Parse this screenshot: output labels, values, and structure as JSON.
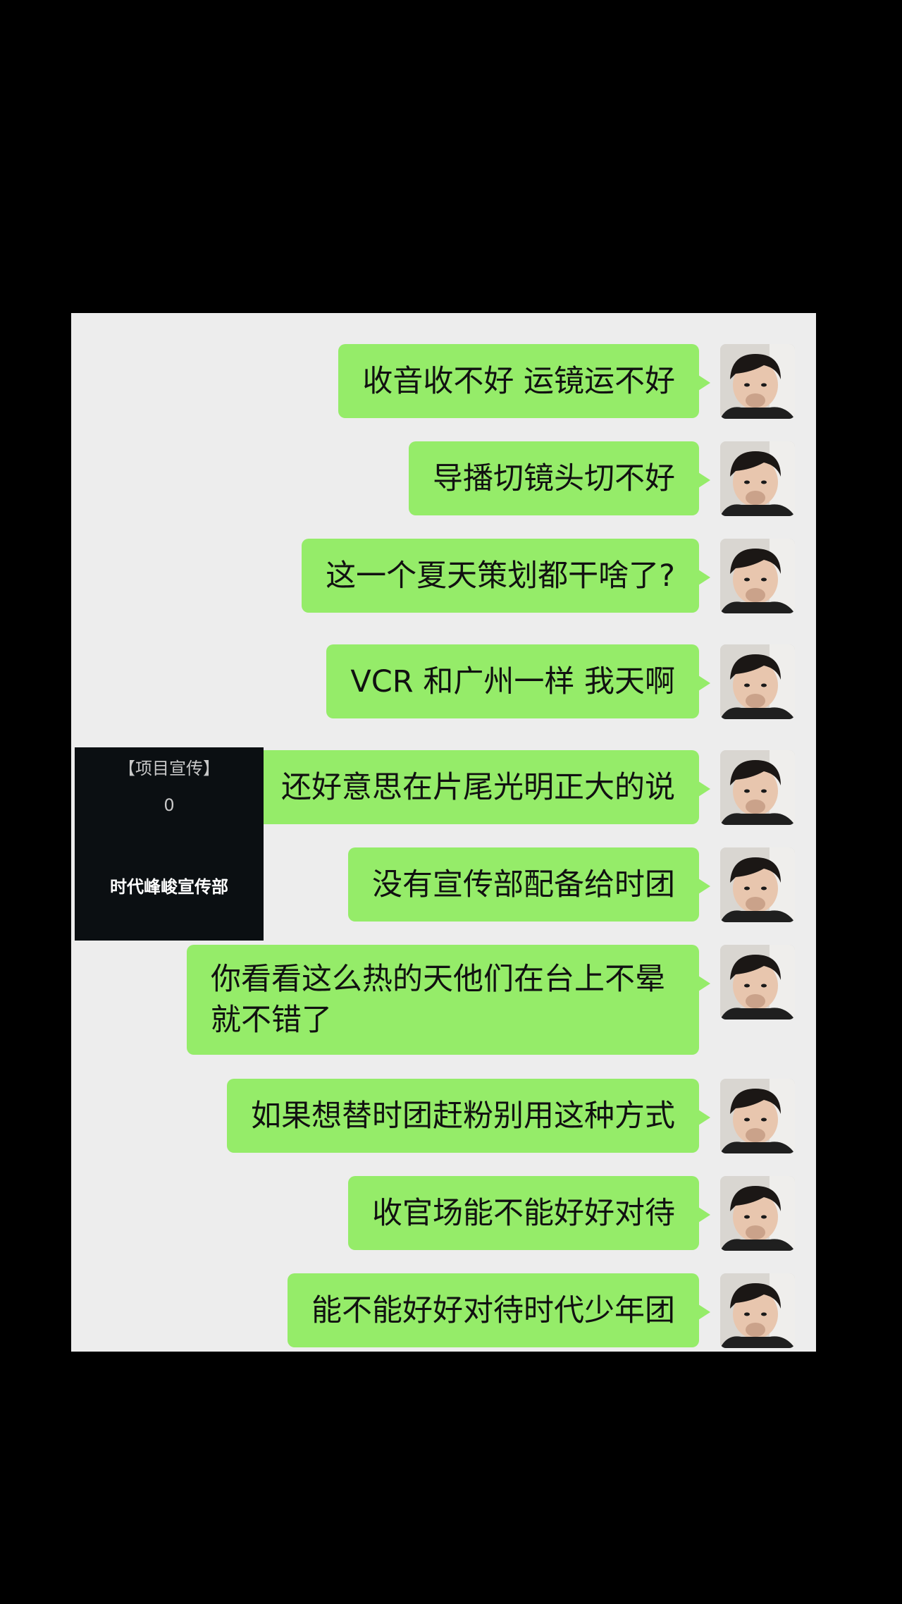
{
  "messages": [
    {
      "text": "收音收不好 运镜运不好"
    },
    {
      "text": "导播切镜头切不好"
    },
    {
      "text": "这一个夏天策划都干啥了?"
    },
    {
      "text": "VCR 和广州一样 我天啊"
    },
    {
      "text": "还好意思在片尾光明正大的说"
    },
    {
      "text": "没有宣传部配备给时团"
    },
    {
      "text": "你看看这么热的天他们在台上不晕就不错了"
    },
    {
      "text": "如果想替时团赶粉别用这种方式"
    },
    {
      "text": "收官场能不能好好对待"
    },
    {
      "text": "能不能好好对待时代少年团"
    }
  ],
  "overlay_card": {
    "tag": "【项目宣传】",
    "count": "0",
    "name": "时代峰峻宣传部"
  },
  "avatar_icon": "user-avatar-icon",
  "colors": {
    "bubble": "#95ec69",
    "chat_background": "#ededed",
    "outer_background": "#000000"
  }
}
